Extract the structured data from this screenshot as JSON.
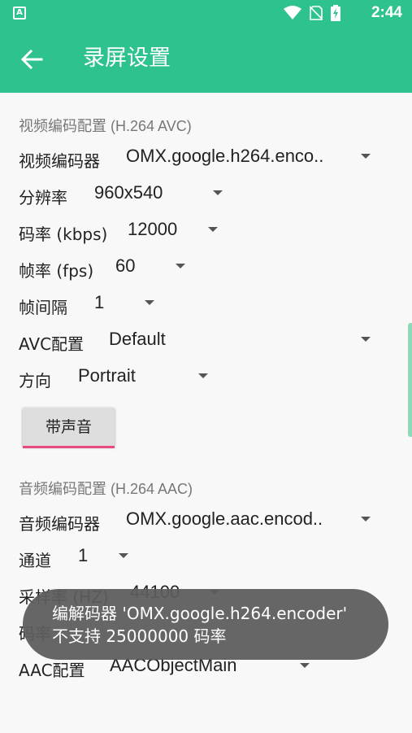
{
  "status_bar": {
    "time": "2:44",
    "notif_letter": "A"
  },
  "app_bar": {
    "title": "录屏设置"
  },
  "video_section": {
    "header": "视频编码配置 (H.264 AVC)",
    "rows": [
      {
        "label": "视频编码器",
        "value": "OMX.google.h264.enco.."
      },
      {
        "label": "分辨率",
        "value": "960x540"
      },
      {
        "label": "码率 (kbps)",
        "value": "12000"
      },
      {
        "label": "帧率 (fps)",
        "value": "60"
      },
      {
        "label": "帧间隔",
        "value": "1"
      },
      {
        "label": "AVC配置",
        "value": "Default"
      },
      {
        "label": "方向",
        "value": "Portrait"
      }
    ],
    "audio_button_label": "带声音"
  },
  "audio_section": {
    "header": "音频编码配置 (H.264 AAC)",
    "rows": [
      {
        "label": "音频编码器",
        "value": "OMX.google.aac.encod.."
      },
      {
        "label": "通道",
        "value": "1"
      },
      {
        "label": "采样率 (HZ)",
        "value": "44100"
      },
      {
        "label": "码率",
        "value": ""
      },
      {
        "label": "AAC配置",
        "value": "AACObjectMain"
      }
    ]
  },
  "toast": {
    "message": "编解码器 'OMX.google.h264.encoder' 不支持 25000000 码率"
  }
}
